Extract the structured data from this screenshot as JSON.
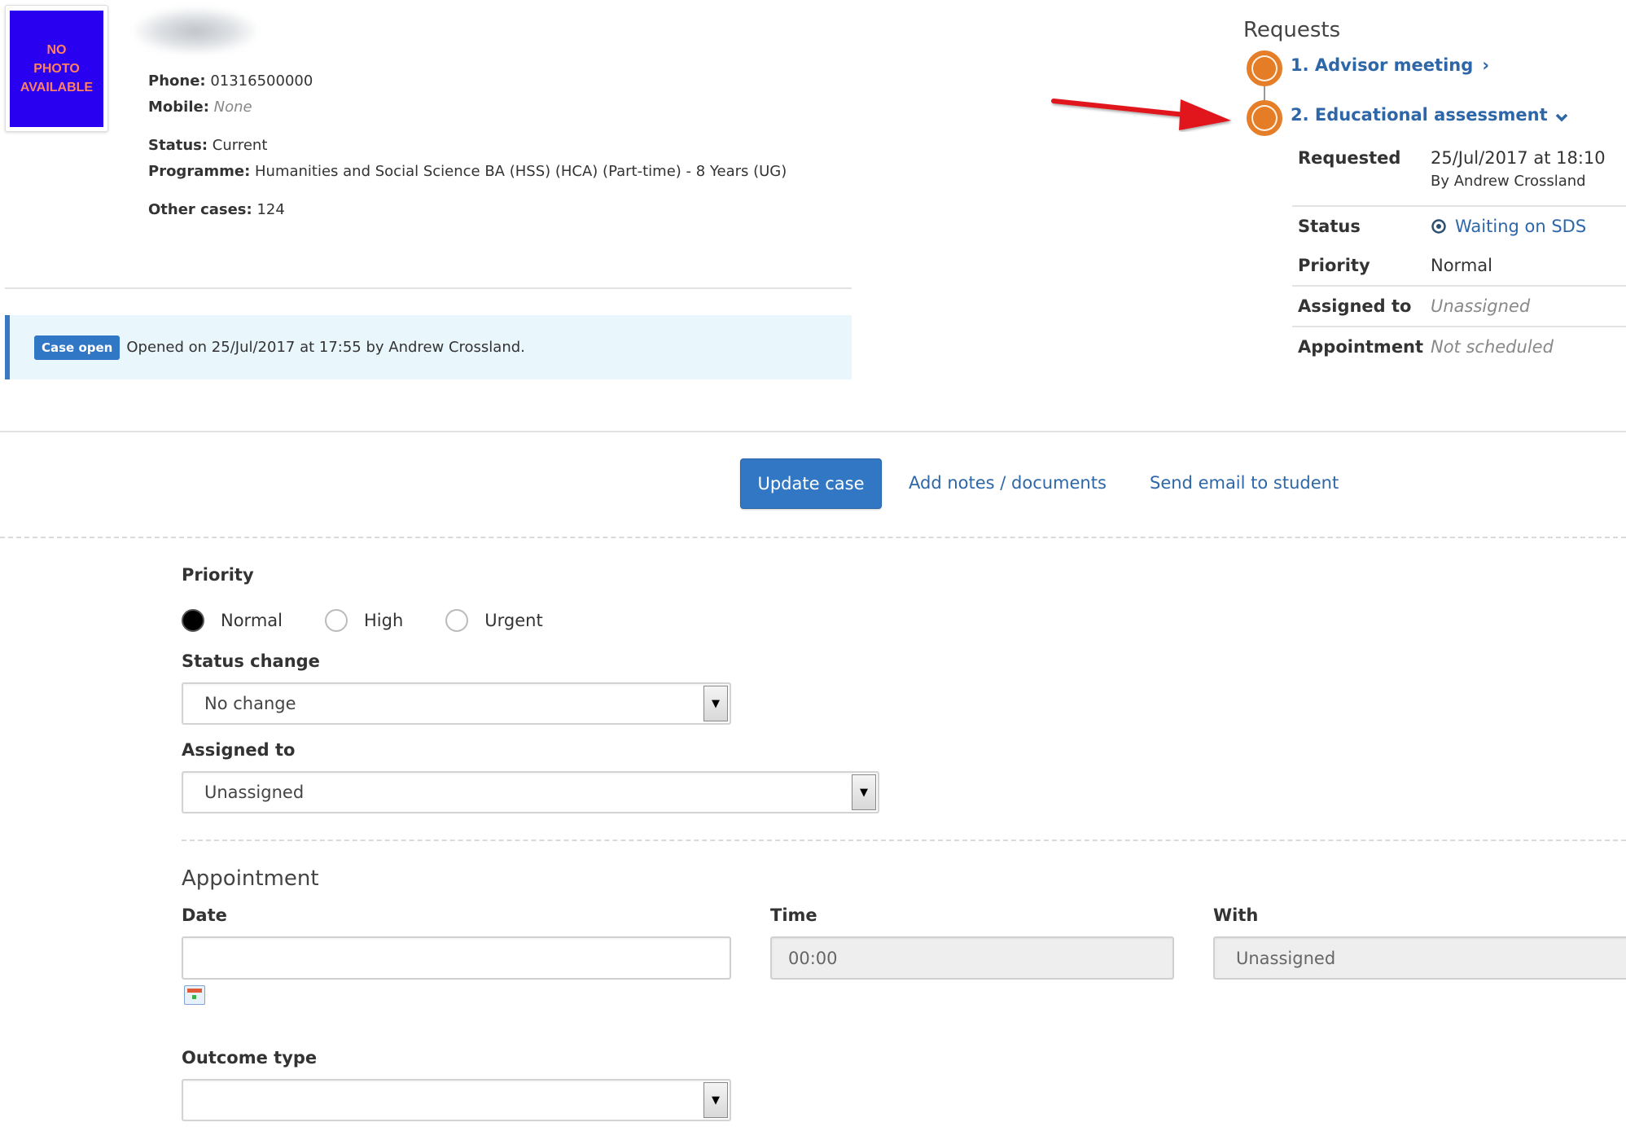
{
  "profile": {
    "photo_placeholder": "NO PHOTO AVAILABLE",
    "photo_lines": [
      "NO",
      "PHOTO",
      "AVAILABLE"
    ],
    "phone_label": "Phone:",
    "phone": "01316500000",
    "mobile_label": "Mobile:",
    "mobile": "None",
    "status_label": "Status:",
    "status": "Current",
    "programme_label": "Programme:",
    "programme": "Humanities and Social Science BA (HSS) (HCA) (Part-time) - 8 Years (UG)",
    "other_cases_label": "Other cases:",
    "other_cases": "124"
  },
  "case_banner": {
    "badge": "Case open",
    "text": "Opened on 25/Jul/2017 at 17:55 by Andrew Crossland."
  },
  "requests": {
    "title": "Requests",
    "items": [
      {
        "label": "1. Advisor meeting",
        "chevron": "›",
        "expanded": false
      },
      {
        "label": "2. Educational assessment",
        "chevron": "⌄",
        "expanded": true
      }
    ],
    "details": {
      "requested_label": "Requested",
      "requested_value": "25/Jul/2017 at 18:10",
      "requested_by": "By Andrew Crossland",
      "status_label": "Status",
      "status_value": "Waiting on SDS",
      "priority_label": "Priority",
      "priority_value": "Normal",
      "assigned_label": "Assigned to",
      "assigned_value": "Unassigned",
      "appointment_label": "Appointment",
      "appointment_value": "Not scheduled"
    }
  },
  "annotation": {
    "type": "red-arrow",
    "color": "#e0141b",
    "points_to": "2. Educational assessment"
  },
  "actions": {
    "update_case": "Update case",
    "add_notes": "Add notes / documents",
    "send_email": "Send email to student"
  },
  "form": {
    "priority_label": "Priority",
    "priority_options": [
      "Normal",
      "High",
      "Urgent"
    ],
    "priority_selected": "Normal",
    "status_change_label": "Status change",
    "status_change_value": "No change",
    "assigned_label": "Assigned to",
    "assigned_value": "Unassigned",
    "appointment_heading": "Appointment",
    "date_label": "Date",
    "date_value": "",
    "time_label": "Time",
    "time_value": "00:00",
    "with_label": "With",
    "with_value": "Unassigned",
    "outcome_label": "Outcome type",
    "outcome_value": ""
  },
  "colors": {
    "accent": "#3277c4",
    "link": "#2e67a8",
    "request_circle": "#e57c26",
    "banner_bg": "#e9f6fb",
    "photo_bg": "#2a00f0"
  }
}
